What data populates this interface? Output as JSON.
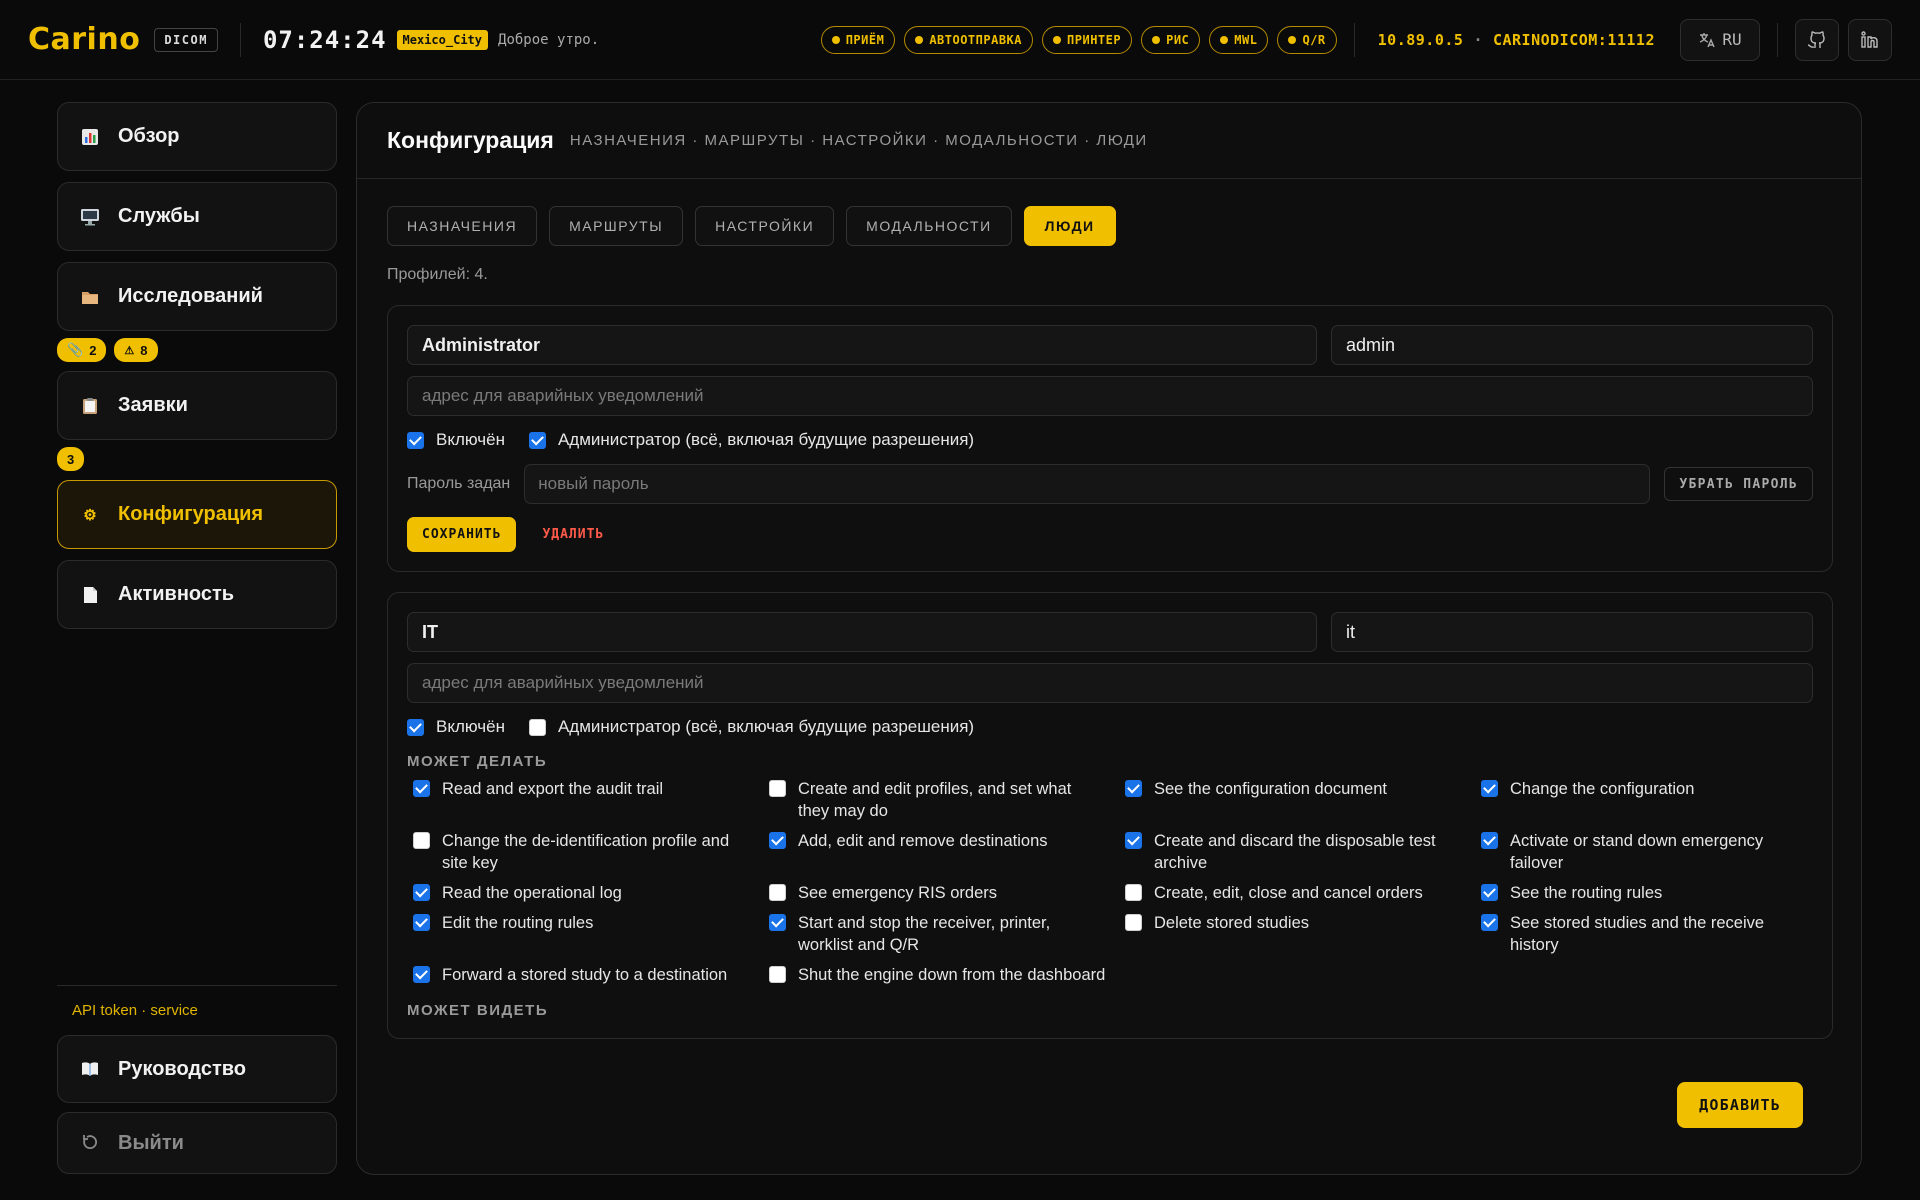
{
  "header": {
    "logo": "Carino",
    "dicom_tag": "DICOM",
    "clock": "07:24:24",
    "timezone": "Mexico_City",
    "greeting": "Доброе утро.",
    "pills": [
      "ПРИЁМ",
      "АВТООТПРАВКА",
      "ПРИНТЕР",
      "РИС",
      "MWL",
      "Q/R"
    ],
    "ip": "10.89.0.5",
    "ae_title": "CARINODICOM:11112",
    "lang": "RU",
    "accent": "#f0c000"
  },
  "sidebar": {
    "items": [
      {
        "label": "Обзор",
        "icon": "chart-icon"
      },
      {
        "label": "Службы",
        "icon": "monitor-icon"
      },
      {
        "label": "Исследований",
        "icon": "folder-icon"
      },
      {
        "label": "Заявки",
        "icon": "clipboard-icon"
      },
      {
        "label": "Конфигурация",
        "icon": "gear-icon"
      },
      {
        "label": "Активность",
        "icon": "document-icon"
      }
    ],
    "studies_badges": [
      "2",
      "8"
    ],
    "orders_badge": "3",
    "api_token": "API token · service",
    "guide": "Руководство",
    "logout": "Выйти"
  },
  "main": {
    "title": "Конфигурация",
    "crumbs": "НАЗНАЧЕНИЯ · МАРШРУТЫ · НАСТРОЙКИ · МОДАЛЬНОСТИ · ЛЮДИ",
    "tabs": [
      "НАЗНАЧЕНИЯ",
      "МАРШРУТЫ",
      "НАСТРОЙКИ",
      "МОДАЛЬНОСТИ",
      "ЛЮДИ"
    ],
    "active_tab": "ЛЮДИ",
    "profile_count": "Профилей: 4.",
    "emergency_placeholder": "адрес для аварийных уведомлений",
    "enabled_label": "Включён",
    "admin_label": "Администратор (всё, включая будущие разрешения)",
    "profiles": [
      {
        "name": "Administrator",
        "login": "admin",
        "enabled": true,
        "admin": true,
        "password_label": "Пароль задан",
        "password_placeholder": "новый пароль",
        "remove_password": "УБРАТЬ ПАРОЛЬ",
        "save": "СОХРАНИТЬ",
        "delete": "УДАЛИТЬ"
      },
      {
        "name": "IT",
        "login": "it",
        "enabled": true,
        "admin": false,
        "can_do_title": "МОЖЕТ ДЕЛАТЬ",
        "can_do": [
          {
            "label": "Read and export the audit trail",
            "checked": true
          },
          {
            "label": "Create and edit profiles, and set what they may do",
            "checked": false
          },
          {
            "label": "See the configuration document",
            "checked": true
          },
          {
            "label": "Change the configuration",
            "checked": true
          },
          {
            "label": "Change the de-identification profile and site key",
            "checked": false
          },
          {
            "label": "Add, edit and remove destinations",
            "checked": true
          },
          {
            "label": "Create and discard the disposable test archive",
            "checked": true
          },
          {
            "label": "Activate or stand down emergency failover",
            "checked": true
          },
          {
            "label": "Read the operational log",
            "checked": true
          },
          {
            "label": "See emergency RIS orders",
            "checked": false
          },
          {
            "label": "Create, edit, close and cancel orders",
            "checked": false
          },
          {
            "label": "See the routing rules",
            "checked": true
          },
          {
            "label": "Edit the routing rules",
            "checked": true
          },
          {
            "label": "Start and stop the receiver, printer, worklist and Q/R",
            "checked": true
          },
          {
            "label": "Delete stored studies",
            "checked": false
          },
          {
            "label": "See stored studies and the receive history",
            "checked": true
          },
          {
            "label": "Forward a stored study to a destination",
            "checked": true
          },
          {
            "label": "Shut the engine down from the dashboard",
            "checked": false
          }
        ],
        "can_see_title": "МОЖЕТ ВИДЕТЬ"
      }
    ],
    "add_button": "ДОБАВИТЬ"
  }
}
